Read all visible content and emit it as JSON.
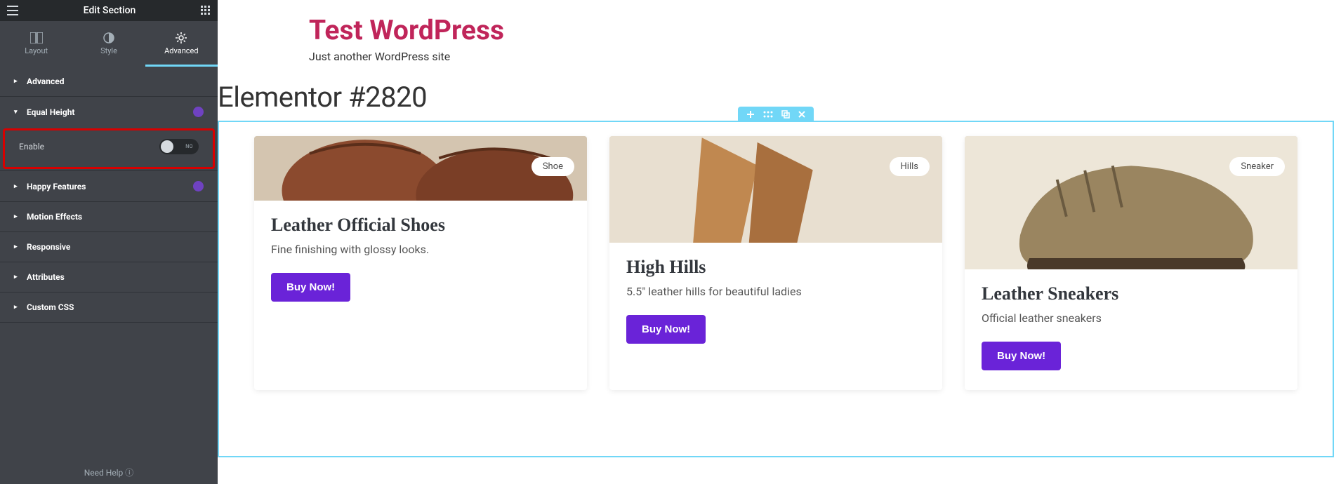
{
  "sidebar": {
    "header_title": "Edit Section",
    "tabs": [
      {
        "label": "Layout"
      },
      {
        "label": "Style"
      },
      {
        "label": "Advanced"
      }
    ],
    "panels": {
      "advanced": "Advanced",
      "equal_height": "Equal Height",
      "happy_features": "Happy Features",
      "motion_effects": "Motion Effects",
      "responsive": "Responsive",
      "attributes": "Attributes",
      "custom_css": "Custom CSS"
    },
    "enable_label": "Enable",
    "toggle_off": "NO",
    "need_help": "Need Help"
  },
  "site": {
    "title": "Test WordPress",
    "tagline": "Just another WordPress site",
    "page_title": "Elementor #2820"
  },
  "cards": [
    {
      "tag": "Shoe",
      "title": "Leather Official Shoes",
      "desc": "Fine finishing with glossy looks.",
      "btn": "Buy Now!"
    },
    {
      "tag": "Hills",
      "title": "High Hills",
      "desc": "5.5\" leather hills for beautiful ladies",
      "btn": "Buy Now!"
    },
    {
      "tag": "Sneaker",
      "title": "Leather Sneakers",
      "desc": "Official leather sneakers",
      "btn": "Buy Now!"
    }
  ],
  "colors": {
    "accent": "#71d7f7",
    "brand": "#c0255a",
    "button": "#6a23d8"
  }
}
